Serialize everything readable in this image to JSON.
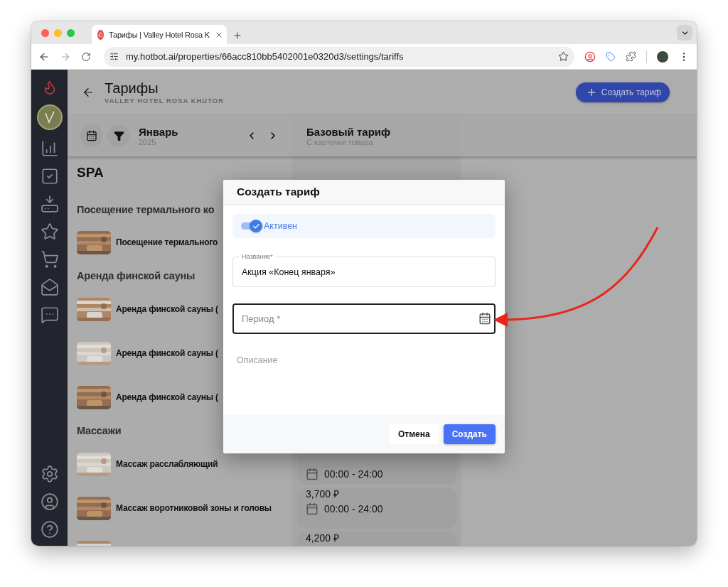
{
  "browser": {
    "tab_title": "Тарифы | Valley Hotel Rosa K",
    "url": "my.hotbot.ai/properties/66acc810bb5402001e0320d3/settings/tariffs"
  },
  "header": {
    "title": "Тарифы",
    "subtitle": "VALLEY HOTEL ROSA KHUTOR",
    "create_button": "Создать тариф"
  },
  "toolbar": {
    "month": "Январь",
    "year": "2025"
  },
  "tariff_column": {
    "title": "Базовый тариф",
    "subtitle": "С карточки товара"
  },
  "section_title": "SPA",
  "groups": [
    {
      "title": "Посещение термального ко",
      "items": [
        {
          "name": "Посещение термального"
        }
      ]
    },
    {
      "title": "Аренда финской сауны",
      "items": [
        {
          "name": "Аренда финской сауны ("
        },
        {
          "name": "Аренда финской сауны ("
        },
        {
          "name": "Аренда финской сауны ("
        }
      ]
    },
    {
      "title": "Массажи",
      "items": [
        {
          "name": "Массаж расслабляющий",
          "card": {
            "time": "00:00 - 24:00"
          }
        },
        {
          "name": "Массаж воротниковой зоны и головы",
          "card": {
            "price": "3,700 ₽",
            "time": "00:00 - 24:00"
          }
        },
        {
          "card": {
            "price": "4,200 ₽"
          }
        }
      ]
    }
  ],
  "dialog": {
    "title": "Создать тариф",
    "active": {
      "label": "Активен",
      "checked": true
    },
    "name_field": {
      "label": "Название*",
      "value": "Акция «Конец января»"
    },
    "period_field": {
      "placeholder": "Период *",
      "focused": true
    },
    "description": {
      "placeholder": "Описание"
    },
    "buttons": {
      "cancel": "Отмена",
      "submit": "Создать"
    }
  }
}
